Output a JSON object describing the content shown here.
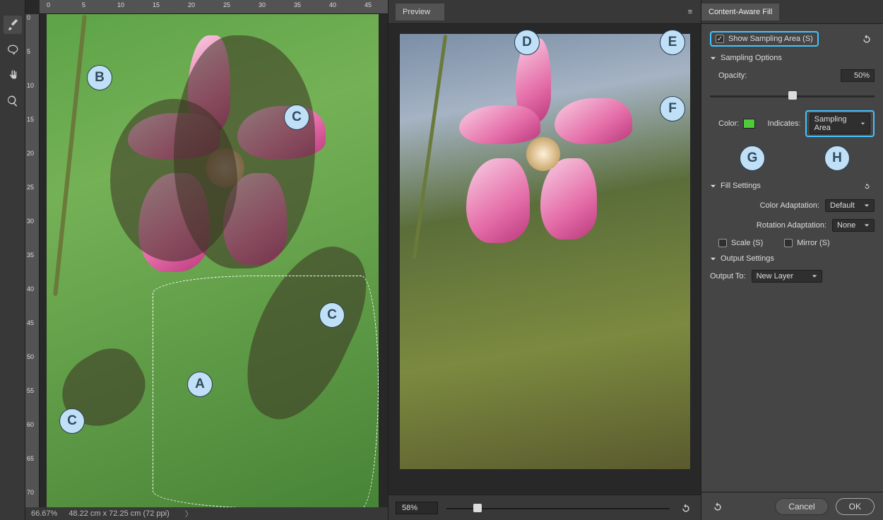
{
  "tools": [
    "brush",
    "lasso",
    "hand",
    "zoom"
  ],
  "ruler_h": [
    "0",
    "5",
    "10",
    "15",
    "20",
    "25",
    "30",
    "35",
    "40",
    "45"
  ],
  "ruler_v": [
    "0",
    "5",
    "10",
    "15",
    "20",
    "25",
    "30",
    "35",
    "40",
    "45",
    "50",
    "55",
    "60",
    "65",
    "70"
  ],
  "callouts": [
    "A",
    "B",
    "C",
    "D",
    "E",
    "F",
    "G",
    "H"
  ],
  "statusbar": {
    "zoom": "66.67%",
    "doc": "48.22 cm x 72.25 cm (72 ppi)"
  },
  "preview": {
    "tab": "Preview",
    "zoom": "58%",
    "slider_pos_pct": 14
  },
  "caf": {
    "title": "Content-Aware Fill",
    "show_sampling": "Show Sampling Area  (S)",
    "sampling_hdr": "Sampling Options",
    "opacity_label": "Opacity:",
    "opacity_value": "50%",
    "opacity_pos_pct": 50,
    "color_label": "Color:",
    "indicates_label": "Indicates:",
    "indicates_value": "Sampling Area",
    "fill_hdr": "Fill Settings",
    "color_adapt_label": "Color Adaptation:",
    "color_adapt_value": "Default",
    "rot_adapt_label": "Rotation Adaptation:",
    "rot_adapt_value": "None",
    "scale_label": "Scale  (S)",
    "mirror_label": "Mirror  (S)",
    "output_hdr": "Output Settings",
    "output_to_label": "Output To:",
    "output_to_value": "New Layer",
    "cancel": "Cancel",
    "ok": "OK"
  }
}
